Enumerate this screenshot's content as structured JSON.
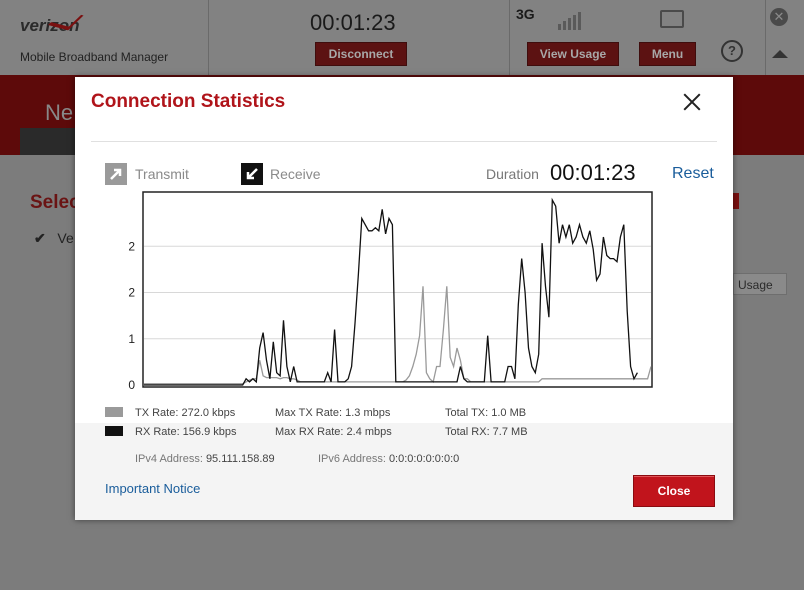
{
  "app": {
    "brand": "verizon",
    "subtitle": "Mobile Broadband Manager",
    "timer": "00:01:23",
    "disconnect_label": "Disconnect",
    "network_type": "3G",
    "view_usage_label": "View Usage",
    "menu_label": "Menu",
    "help_label": "?",
    "bg_heading_partial": "Ne",
    "bg_select_partial": "Selec",
    "bg_item_partial": "Ve",
    "bg_usage_partial": "Usage"
  },
  "dialog": {
    "title": "Connection Statistics",
    "transmit_label": "Transmit",
    "receive_label": "Receive",
    "duration_label": "Duration",
    "duration_value": "00:01:23",
    "reset_label": "Reset",
    "stats": {
      "tx_rate": "TX Rate: 272.0 kbps",
      "rx_rate": "RX Rate: 156.9 kbps",
      "max_tx": "Max TX Rate: 1.3 mbps",
      "max_rx": "Max RX Rate: 2.4 mbps",
      "total_tx": "Total TX: 1.0 MB",
      "total_rx": "Total RX: 7.7 MB"
    },
    "ipv4_label": "IPv4 Address:",
    "ipv4_value": "95.111.158.89",
    "ipv6_label": "IPv6 Address:",
    "ipv6_value": "0:0:0:0:0:0:0:0",
    "notice_label": "Important Notice",
    "close_label": "Close",
    "colors": {
      "title": "#b0141a",
      "link": "#1a5d9b",
      "close_button": "#c1141c",
      "tx_series": "#9a9a9a",
      "rx_series": "#111111"
    }
  },
  "chart_data": {
    "type": "line",
    "y_tick_labels": [
      "0",
      "1",
      "2",
      "2"
    ],
    "ylim": [
      0,
      3.0
    ],
    "grid": true,
    "x": [
      0,
      1,
      2,
      3,
      4,
      5,
      6,
      7,
      8,
      9,
      10,
      11,
      12,
      13,
      14,
      15,
      16,
      17,
      18,
      19,
      20,
      21,
      22,
      23,
      24,
      25,
      26,
      27,
      28,
      29,
      30,
      31,
      32,
      33,
      34,
      35,
      36,
      37,
      38,
      39,
      40,
      41,
      42,
      43,
      44,
      45,
      46,
      47,
      48,
      49,
      50,
      51,
      52,
      53,
      54,
      55,
      56,
      57,
      58,
      59,
      60,
      61,
      62,
      63,
      64,
      65,
      66,
      67,
      68,
      69,
      70,
      71,
      72,
      73,
      74,
      75,
      76,
      77,
      78,
      79,
      80,
      81,
      82,
      83,
      84,
      85,
      86,
      87,
      88,
      89,
      90,
      91,
      92,
      93,
      94,
      95,
      96,
      97,
      98,
      99,
      100,
      101,
      102,
      103,
      104,
      105,
      106,
      107,
      108,
      109,
      110,
      111,
      112,
      113,
      114,
      115,
      116,
      117,
      118,
      119,
      120,
      121,
      122,
      123,
      124,
      125,
      126,
      127,
      128,
      129,
      130,
      131,
      132,
      133,
      134,
      135,
      136,
      137,
      138,
      139,
      140,
      141,
      142,
      143,
      144,
      145,
      146,
      147,
      148,
      149
    ],
    "series": [
      {
        "name": "TX",
        "values": [
          0.02,
          0.02,
          0.02,
          0.02,
          0.02,
          0.02,
          0.02,
          0.02,
          0.02,
          0.02,
          0.02,
          0.02,
          0.02,
          0.02,
          0.02,
          0.02,
          0.02,
          0.02,
          0.02,
          0.02,
          0.02,
          0.02,
          0.02,
          0.02,
          0.02,
          0.02,
          0.02,
          0.02,
          0.02,
          0.02,
          0.05,
          0.08,
          0.1,
          0.1,
          0.4,
          0.15,
          0.12,
          0.12,
          0.12,
          0.12,
          0.1,
          0.12,
          0.12,
          0.1,
          0.1,
          0.08,
          0.05,
          0.05,
          0.05,
          0.05,
          0.05,
          0.05,
          0.05,
          0.05,
          0.05,
          0.05,
          0.05,
          0.05,
          0.05,
          0.05,
          0.05,
          0.05,
          0.05,
          0.05,
          0.05,
          0.05,
          0.05,
          0.05,
          0.05,
          0.05,
          0.05,
          0.05,
          0.05,
          0.05,
          0.05,
          0.05,
          0.05,
          0.08,
          0.15,
          0.3,
          0.5,
          0.8,
          1.6,
          0.2,
          0.1,
          0.05,
          0.3,
          0.3,
          0.9,
          1.6,
          0.45,
          0.3,
          0.6,
          0.4,
          0.1,
          0.1,
          0.05,
          0.05,
          0.05,
          0.05,
          0.05,
          0.05,
          0.05,
          0.05,
          0.05,
          0.05,
          0.05,
          0.05,
          0.05,
          0.05,
          0.05,
          0.05,
          0.05,
          0.05,
          0.05,
          0.05,
          0.05,
          0.1,
          0.1,
          0.1,
          0.1,
          0.1,
          0.1,
          0.1,
          0.1,
          0.1,
          0.1,
          0.1,
          0.1,
          0.1,
          0.1,
          0.1,
          0.1,
          0.1,
          0.1,
          0.1,
          0.1,
          0.1,
          0.1,
          0.1,
          0.1,
          0.1,
          0.1,
          0.1,
          0.1,
          0.1,
          0.1,
          0.1,
          0.1,
          0.3
        ]
      },
      {
        "name": "RX",
        "values": [
          0.0,
          0.0,
          0.0,
          0.0,
          0.0,
          0.0,
          0.0,
          0.0,
          0.0,
          0.0,
          0.0,
          0.0,
          0.0,
          0.0,
          0.0,
          0.0,
          0.0,
          0.0,
          0.0,
          0.0,
          0.0,
          0.0,
          0.0,
          0.0,
          0.0,
          0.0,
          0.0,
          0.0,
          0.0,
          0.0,
          0.1,
          0.05,
          0.1,
          0.05,
          0.6,
          0.85,
          0.4,
          0.1,
          0.7,
          0.2,
          0.15,
          1.05,
          0.3,
          0.05,
          0.3,
          0.05,
          0.05,
          0.05,
          0.05,
          0.05,
          0.05,
          0.05,
          0.05,
          0.05,
          0.2,
          0.05,
          0.9,
          0.05,
          0.05,
          0.05,
          0.1,
          0.3,
          1.0,
          1.8,
          2.7,
          2.6,
          2.5,
          2.5,
          2.55,
          2.5,
          2.85,
          2.45,
          2.7,
          2.6,
          0.05,
          0.05,
          0.05,
          0.05,
          0.05,
          0.05,
          0.05,
          0.05,
          0.05,
          0.05,
          0.05,
          0.05,
          0.05,
          0.05,
          0.05,
          0.05,
          0.05,
          0.05,
          0.05,
          0.3,
          0.1,
          0.05,
          0.05,
          0.05,
          0.05,
          0.05,
          0.05,
          0.8,
          0.05,
          0.05,
          0.05,
          0.05,
          0.05,
          0.3,
          0.3,
          0.1,
          1.3,
          2.05,
          1.5,
          0.6,
          0.3,
          0.2,
          0.5,
          2.3,
          1.6,
          1.1,
          3.0,
          2.9,
          2.3,
          2.6,
          2.4,
          2.6,
          2.3,
          2.4,
          2.6,
          2.4,
          2.3,
          2.5,
          2.2,
          1.7,
          1.8,
          2.4,
          2.1,
          2.05,
          2.05,
          2.0,
          2.4,
          2.6,
          1.2,
          0.3,
          0.1,
          0.2
        ]
      }
    ]
  }
}
